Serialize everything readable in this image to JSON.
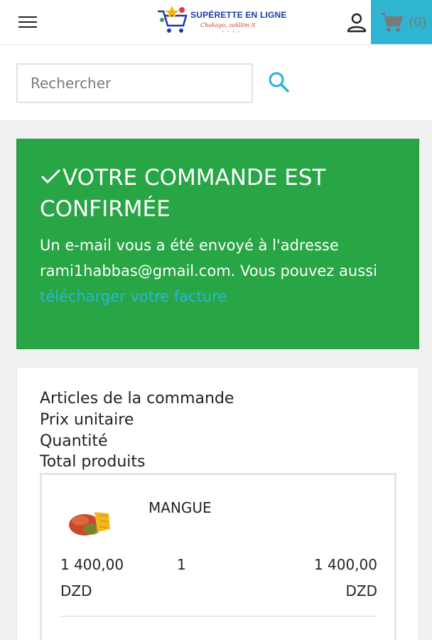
{
  "header": {
    "logo_text": "SUPÉRETTE EN LIGNE",
    "logo_tagline": "Chakayo, zakllim it",
    "logo_sub": "• • • •",
    "cart_count": "(0)"
  },
  "search": {
    "placeholder": "Rechercher"
  },
  "confirmation": {
    "title": "VOTRE COMMANDE EST CONFIRMÉE",
    "message": "Un e-mail vous a été envoyé à l'adresse rami1habbas@gmail.com. Vous pouvez aussi",
    "invoice_link": "télécharger votre facture"
  },
  "order": {
    "headers": [
      "Articles de la commande",
      "Prix unitaire",
      "Quantité",
      "Total produits"
    ],
    "items": [
      {
        "name": "MANGUE",
        "unit_price": "1 400,00 DZD",
        "quantity": "1",
        "total": "1 400,00 DZD"
      }
    ]
  },
  "colors": {
    "accent": "#2fb5d2",
    "success": "#28a545"
  },
  "icons": {
    "menu": "menu-icon",
    "user": "user-icon",
    "cart": "cart-icon",
    "search": "search-icon",
    "check": "check-icon"
  }
}
